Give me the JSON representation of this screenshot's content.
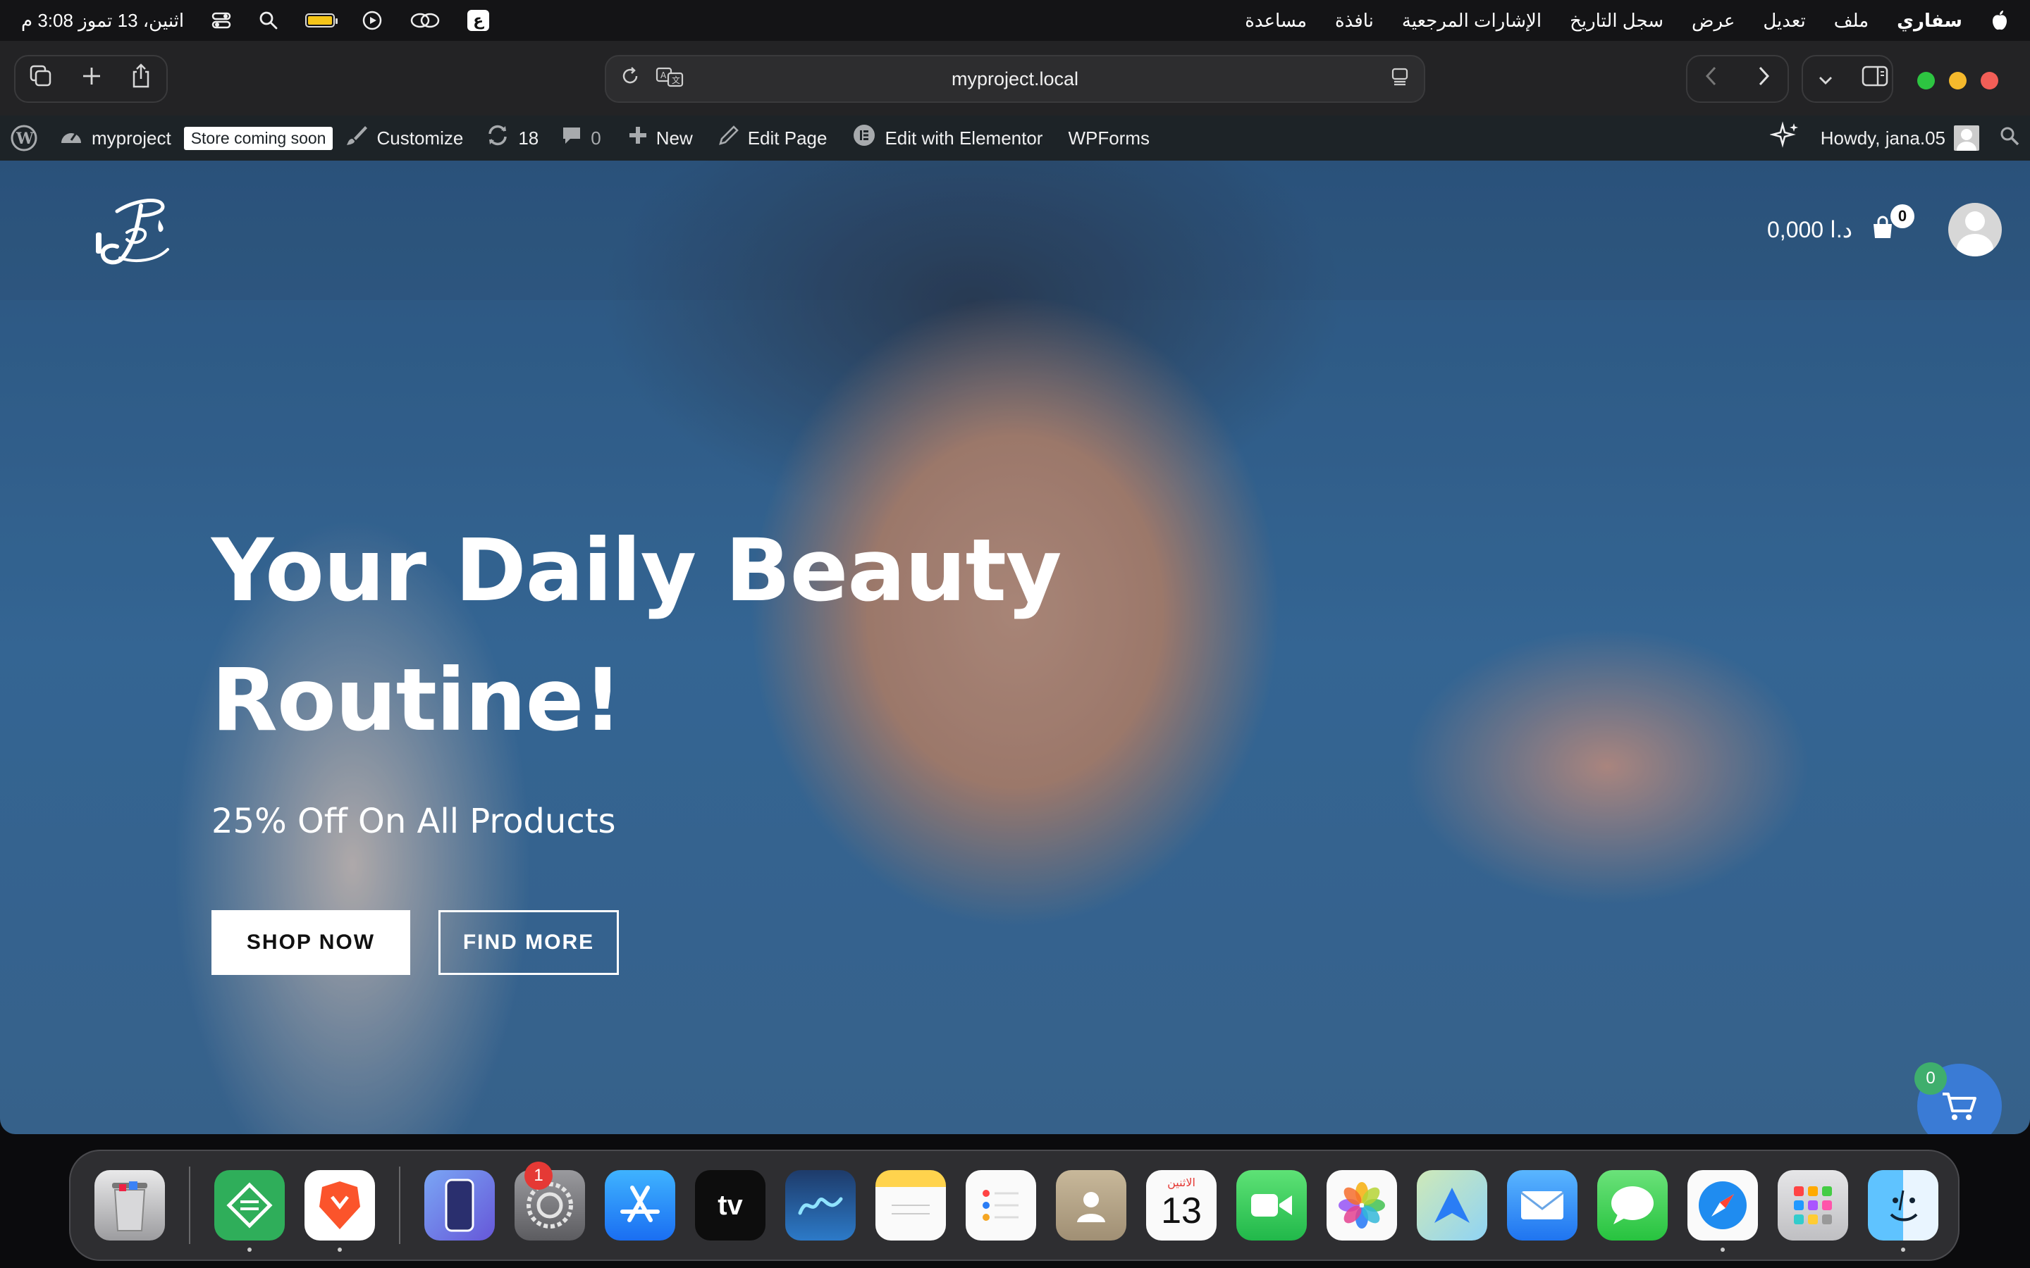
{
  "menubar": {
    "apple": "",
    "app_name": "سفاري",
    "menus": [
      "ملف",
      "تعديل",
      "عرض",
      "سجل التاريخ",
      "الإشارات المرجعية",
      "نافذة",
      "مساعدة"
    ],
    "datetime": "اثنين، 13 تموز 3:08 م",
    "lang": "ع"
  },
  "browser": {
    "url": "myproject.local"
  },
  "adminbar": {
    "site_name": "myproject",
    "store_badge": "Store coming soon",
    "customize": "Customize",
    "updates_count": "18",
    "comments_count": "0",
    "new": "New",
    "edit_page": "Edit Page",
    "edit_elementor": "Edit with Elementor",
    "wpforms": "WPForms",
    "howdy": "Howdy, jana.05"
  },
  "header": {
    "price": "0,000 د.ا",
    "cart_count": "0"
  },
  "hero": {
    "title_line1": "Your Daily Beauty",
    "title_line2": "Routine!",
    "subtitle": "25% Off On All Products",
    "shop_button": "SHOP NOW",
    "find_button": "FIND MORE"
  },
  "floating_cart": {
    "count": "0"
  },
  "dock": {
    "settings_badge": "1",
    "calendar_weekday": "الاثنين",
    "calendar_day": "13"
  },
  "colors": {
    "adminbar": "#1d2327",
    "float_cart": "#3a7bd5",
    "float_cart_badge": "#3fae6d"
  }
}
